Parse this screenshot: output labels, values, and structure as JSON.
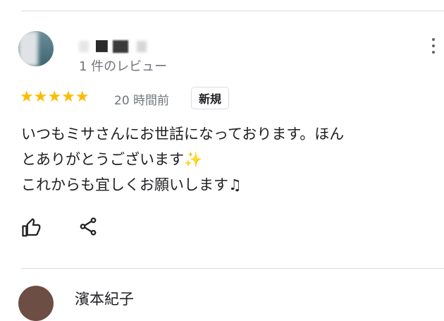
{
  "review1": {
    "name": "■",
    "reviews_count": "1 件のレビュー",
    "stars": "★★★★★",
    "time": "20 時間前",
    "badge": "新規",
    "lines": [
      "いつもミサさんにお世話になっております。ほん",
      "とありがとうございます",
      "これからも宜しくお願いします"
    ],
    "emoji_sparkles": "✨",
    "emoji_note": "♫"
  },
  "review2": {
    "name_partial": "濱本紀子"
  },
  "icons": {
    "like": "thumbs-up-icon",
    "share": "share-icon",
    "more": "more-vert-icon"
  },
  "colors": {
    "star": "#fbbc04",
    "secondary_text": "#70757a",
    "divider": "#dadce0"
  }
}
